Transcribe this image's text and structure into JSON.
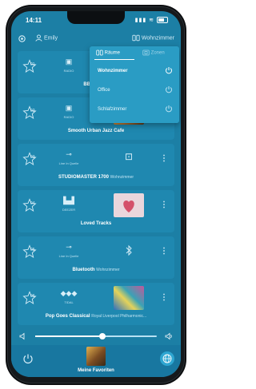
{
  "status": {
    "time": "14:11"
  },
  "header": {
    "user": "Emily",
    "room": "Wohnzimmer"
  },
  "dropdown": {
    "tabs": [
      "Räume",
      "Zonen"
    ],
    "rooms": [
      {
        "label": "Wohnzimmer",
        "selected": true
      },
      {
        "label": "Office",
        "selected": false
      },
      {
        "label": "Schlafzimmer",
        "selected": false
      }
    ]
  },
  "favorites": [
    {
      "num": "01",
      "source": "RADIO",
      "title": "BBC Radio",
      "subtitle": "",
      "icon": "radio-icon"
    },
    {
      "num": "02",
      "source": "RADIO",
      "title": "Smooth Urban Jazz Cafe",
      "subtitle": "",
      "icon": "radio-icon"
    },
    {
      "num": "03",
      "source": "Line In Quelle",
      "title": "STUDIOMASTER 1700",
      "subtitle": "Wohnzimmer",
      "icon": "line-in-icon"
    },
    {
      "num": "04",
      "source": "DEEZER",
      "title": "Loved Tracks",
      "subtitle": "",
      "icon": "deezer-icon"
    },
    {
      "num": "05",
      "source": "Line In Quelle",
      "title": "Bluetooth",
      "subtitle": "Wohnzimmer",
      "icon": "line-in-icon"
    },
    {
      "num": "06",
      "source": "TIDAL",
      "title": "Pop Goes Classical",
      "subtitle": "Royal Liverpool Philharmonic...",
      "icon": "tidal-icon"
    }
  ],
  "volume": {
    "level": 0.55
  },
  "bottom": {
    "label": "Meine Favoriten"
  },
  "colors": {
    "accent": "#1c7fa5",
    "row": "#1f88b0",
    "dropdown": "#2a9cc4"
  }
}
